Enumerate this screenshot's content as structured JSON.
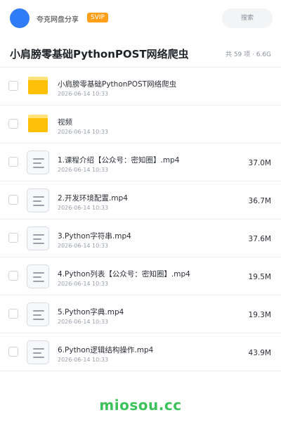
{
  "header": {
    "brand": "夸克网盘分享",
    "vip_badge": "SVIP",
    "search_label": "搜索",
    "avatar_color": "#2f7cf6"
  },
  "share": {
    "title": "小肩膀零基础PythonPOST网络爬虫",
    "meta": "共 59 项 · 6.6G"
  },
  "items": [
    {
      "type": "folder",
      "name": "小肩膀零基础PythonPOST网络爬虫",
      "date": "2026-06-14 10:33",
      "size": ""
    },
    {
      "type": "folder",
      "name": "视频",
      "date": "2026-06-14 10:33",
      "size": ""
    },
    {
      "type": "file",
      "name": "1.课程介绍【公众号：密知圈】.mp4",
      "date": "2026-06-14 10:33",
      "size": "37.0M"
    },
    {
      "type": "file",
      "name": "2.开发环境配置.mp4",
      "date": "2026-06-14 10:33",
      "size": "36.7M"
    },
    {
      "type": "file",
      "name": "3.Python字符串.mp4",
      "date": "2026-06-14 10:33",
      "size": "37.6M"
    },
    {
      "type": "file",
      "name": "4.Python列表【公众号：密知圈】.mp4",
      "date": "2026-06-14 10:33",
      "size": "19.5M"
    },
    {
      "type": "file",
      "name": "5.Python字典.mp4",
      "date": "2026-06-14 10:33",
      "size": "19.3M"
    },
    {
      "type": "file",
      "name": "6.Python逻辑结构操作.mp4",
      "date": "2026-06-14 10:33",
      "size": "43.9M"
    }
  ],
  "icons": {
    "folder": "folder-icon",
    "file": "document-icon"
  },
  "watermark": "miosou.cc",
  "colors": {
    "accent": "#2f7cf6",
    "vip": "#ff9f1a",
    "folder": "#ffc107",
    "watermark": "#3cc25a"
  }
}
